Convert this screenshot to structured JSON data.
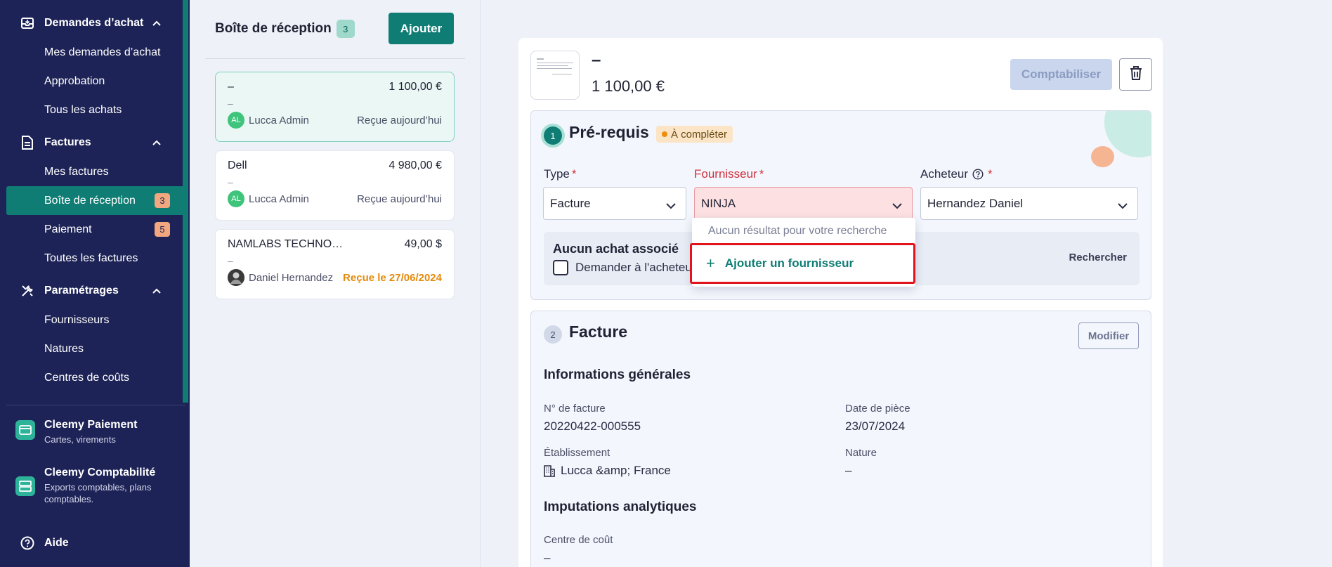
{
  "sidebar": {
    "groups": [
      {
        "title": "Demandes d’achat",
        "items": [
          {
            "label": "Mes demandes d’achat"
          },
          {
            "label": "Approbation"
          },
          {
            "label": "Tous les achats"
          }
        ]
      },
      {
        "title": "Factures",
        "items": [
          {
            "label": "Mes factures"
          },
          {
            "label": "Boîte de réception",
            "badge": "3"
          },
          {
            "label": "Paiement",
            "badge": "5"
          },
          {
            "label": "Toutes les factures"
          }
        ]
      },
      {
        "title": "Paramétrages",
        "items": [
          {
            "label": "Fournisseurs"
          },
          {
            "label": "Natures"
          },
          {
            "label": "Centres de coûts"
          }
        ]
      }
    ],
    "apps": [
      {
        "title": "Cleemy Paiement",
        "subtitle": "Cartes, virements"
      },
      {
        "title": "Cleemy Comptabilité",
        "subtitle": "Exports comptables, plans comptables."
      }
    ],
    "help": "Aide"
  },
  "inbox": {
    "title": "Boîte de réception",
    "count": "3",
    "add_label": "Ajouter",
    "cards": [
      {
        "name": "–",
        "amount": "1 100,00 €",
        "sub": "–",
        "avatar": "AL",
        "user": "Lucca Admin",
        "received": "Reçue aujourd’hui"
      },
      {
        "name": "Dell",
        "amount": "4 980,00 €",
        "sub": "–",
        "avatar": "AL",
        "user": "Lucca Admin",
        "received": "Reçue aujourd’hui"
      },
      {
        "name": "NAMLABS TECHNO…",
        "amount": "49,00 $",
        "sub": "–",
        "avatar": "",
        "user": "Daniel Hernandez",
        "received": "Reçue le 27/06/2024"
      }
    ]
  },
  "doc": {
    "title": "–",
    "amount": "1 100,00 €",
    "post_label": "Comptabiliser"
  },
  "prereq": {
    "number": "1",
    "title": "Pré-requis",
    "status": "À compléter",
    "type_label": "Type",
    "type_value": "Facture",
    "supplier_label": "Fournisseur",
    "supplier_value": "NINJA",
    "buyer_label": "Acheteur",
    "buyer_value": "Hernandez Daniel",
    "assoc_title": "Aucun achat associé",
    "assoc_checkbox": "Demander à l'acheteur",
    "search_label": "Rechercher",
    "dropdown_empty": "Aucun résultat pour votre recherche",
    "dropdown_add": "Ajouter un fournisseur"
  },
  "invoice": {
    "number": "2",
    "title": "Facture",
    "edit_label": "Modifier",
    "general_title": "Informations générales",
    "invoice_no_label": "N° de facture",
    "invoice_no_value": "20220422-000555",
    "date_label": "Date de pièce",
    "date_value": "23/07/2024",
    "entity_label": "Établissement",
    "entity_value": "Lucca &amp; France",
    "nature_label": "Nature",
    "nature_value": "–",
    "analytics_title": "Imputations analytiques",
    "cost_center_label": "Centre de coût",
    "cost_center_value": "–"
  },
  "colors": {
    "sidebar": "#1d2356",
    "accent": "#0f7d74",
    "error": "#d0303c",
    "badge": "#f3a77f"
  }
}
